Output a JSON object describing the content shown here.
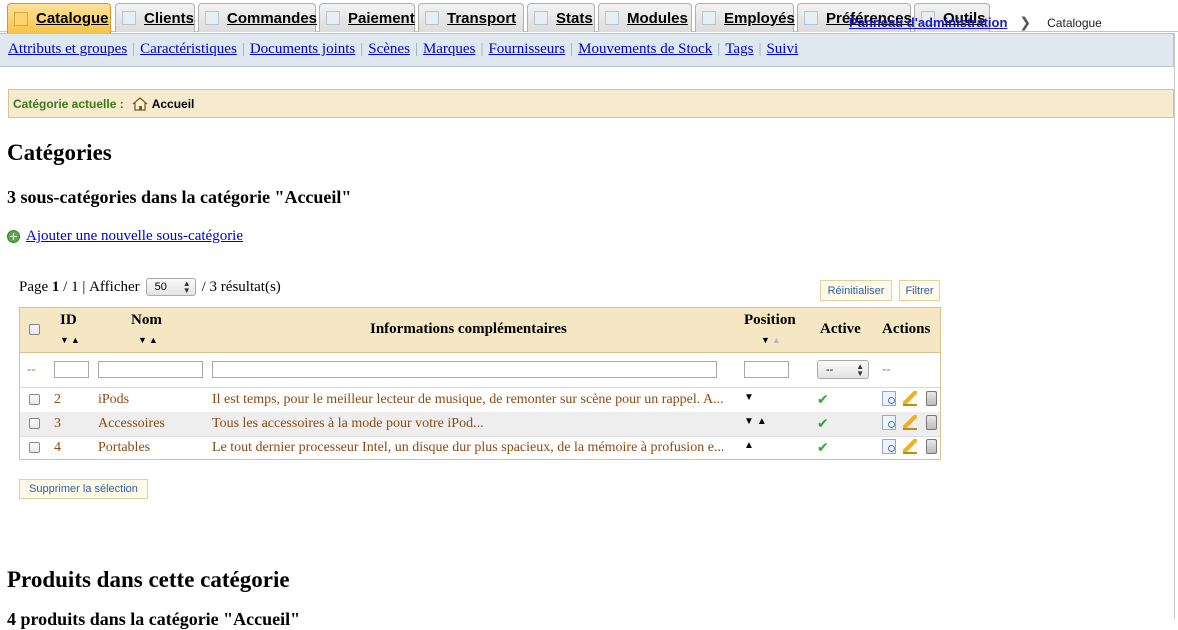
{
  "tabs": [
    {
      "label": "Catalogue",
      "active": true
    },
    {
      "label": "Clients"
    },
    {
      "label": "Commandes"
    },
    {
      "label": "Paiement"
    },
    {
      "label": "Transport"
    },
    {
      "label": "Stats"
    },
    {
      "label": "Modules"
    },
    {
      "label": "Employés"
    },
    {
      "label": "Préférences"
    },
    {
      "label": "Outils"
    }
  ],
  "subnav": {
    "links": [
      "Attributs et groupes",
      "Caractéristiques",
      "Documents joints",
      "Scènes",
      "Marques",
      "Fournisseurs",
      "Mouvements de Stock",
      "Tags",
      "Suivi"
    ],
    "breadcrumb_link": "Panneau d'administration",
    "breadcrumb_current": "Catalogue"
  },
  "current_category": {
    "label": "Catégorie actuelle :",
    "value": "Accueil"
  },
  "categories": {
    "title": "Catégories",
    "subtitle": "3 sous-catégories dans la catégorie \"Accueil\"",
    "add_link": "Ajouter une nouvelle sous-catégorie"
  },
  "pager": {
    "page_word": "Page",
    "page": "1",
    "total_pages": "/ 1 |",
    "show_label": "Afficher",
    "per_page": "50",
    "results": "/ 3 résultat(s)"
  },
  "buttons": {
    "reset": "Réinitialiser",
    "filter": "Filtrer",
    "delete_selection": "Supprimer la sélection"
  },
  "table": {
    "headers": {
      "id": "ID",
      "name": "Nom",
      "info": "Informations complémentaires",
      "position": "Position",
      "active": "Active",
      "actions": "Actions"
    },
    "filter_dash": "--",
    "active_filter": "--",
    "rows": [
      {
        "id": "2",
        "name": "iPods",
        "info": "Il est temps, pour le meilleur lecteur de musique, de remonter sur scène pour un rappel. A...",
        "position_arrows": "▼",
        "active": "✔"
      },
      {
        "id": "3",
        "name": "Accessoires",
        "info": "Tous les accessoires à la mode pour votre iPod...",
        "position_arrows": "▼▲",
        "active": "✔"
      },
      {
        "id": "4",
        "name": "Portables",
        "info": "Le tout dernier processeur Intel, un disque dur plus spacieux, de la mémoire à profusion e...",
        "position_arrows": "▲",
        "active": "✔"
      }
    ]
  },
  "products": {
    "title": "Produits dans cette catégorie",
    "subtitle": "4 produits dans la catégorie \"Accueil\""
  },
  "icons": {
    "tab": "tab-icon",
    "home": "home-icon",
    "add": "plus-circle-icon",
    "view": "view-icon",
    "edit": "edit-pencil-icon",
    "delete": "trash-icon",
    "active": "checkmark-icon"
  },
  "colors": {
    "tab_active": "#f6c44a",
    "header_bg": "#f5e6c4",
    "category_bar": "#f6ebce",
    "row_text": "#8b4a12",
    "link": "#0000cc"
  }
}
